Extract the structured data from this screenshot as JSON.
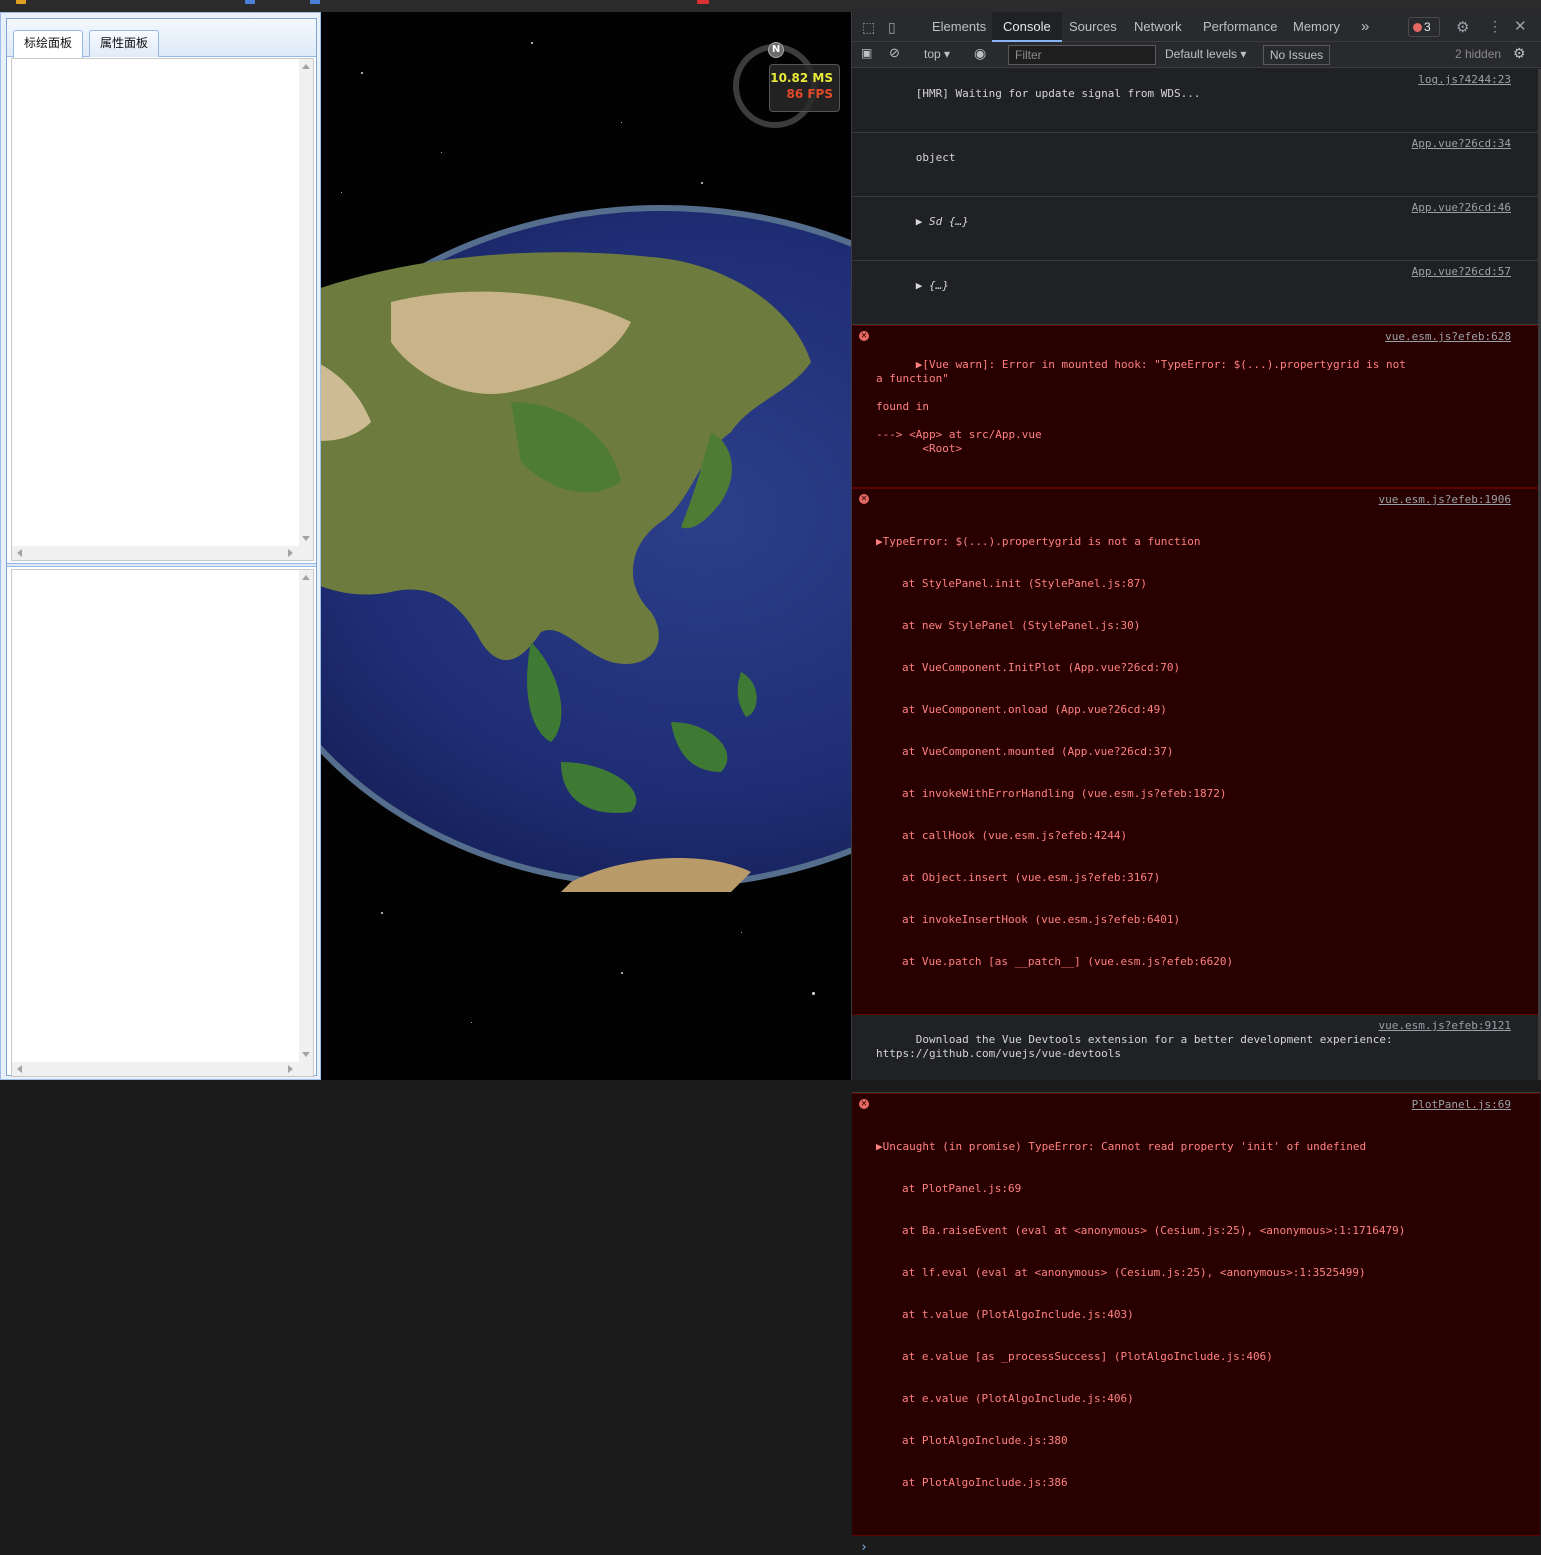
{
  "left_panel": {
    "tabs": [
      {
        "label": "标绘面板",
        "active": true
      },
      {
        "label": "属性面板",
        "active": false
      }
    ]
  },
  "viewport": {
    "perf_ms": "10.82 MS",
    "perf_fps": "86 FPS",
    "compass_label": "N"
  },
  "devtools": {
    "tabs": [
      "Elements",
      "Console",
      "Sources",
      "Network",
      "Performance",
      "Memory"
    ],
    "active_tab": "Console",
    "more_tabs": "»",
    "error_count": "3",
    "toolbar": {
      "context": "top",
      "filter_placeholder": "Filter",
      "levels": "Default levels",
      "issues": "No Issues",
      "hidden": "2 hidden"
    },
    "messages": [
      {
        "type": "log",
        "text": "[HMR] Waiting for update signal from WDS...",
        "source": "log.js?4244:23"
      },
      {
        "type": "log",
        "text": "object",
        "source": "App.vue?26cd:34"
      },
      {
        "type": "log",
        "text": "▶ Sd {…}",
        "source": "App.vue?26cd:46"
      },
      {
        "type": "log",
        "text": "▶ {…}",
        "source": "App.vue?26cd:57"
      },
      {
        "type": "error",
        "text": "▶[Vue warn]: Error in mounted hook: \"TypeError: $(...).propertygrid is not\na function\"\n\nfound in\n\n---> <App> at src/App.vue\n       <Root>",
        "source": "vue.esm.js?efeb:628"
      },
      {
        "type": "error",
        "text": "▶TypeError: $(...).propertygrid is not a function",
        "source": "vue.esm.js?efeb:1906",
        "stack": [
          "at StylePanel.init (StylePanel.js:87)",
          "at new StylePanel (StylePanel.js:30)",
          "at VueComponent.InitPlot (App.vue?26cd:70)",
          "at VueComponent.onload (App.vue?26cd:49)",
          "at VueComponent.mounted (App.vue?26cd:37)",
          "at invokeWithErrorHandling (vue.esm.js?efeb:1872)",
          "at callHook (vue.esm.js?efeb:4244)",
          "at Object.insert (vue.esm.js?efeb:3167)",
          "at invokeInsertHook (vue.esm.js?efeb:6401)",
          "at Vue.patch [as __patch__] (vue.esm.js?efeb:6620)"
        ]
      },
      {
        "type": "log",
        "text": "Download the Vue Devtools extension for a better development experience:\nhttps://github.com/vuejs/vue-devtools",
        "source": "vue.esm.js?efeb:9121"
      },
      {
        "type": "error",
        "text": "▶Uncaught (in promise) TypeError: Cannot read property 'init' of undefined",
        "source": "PlotPanel.js:69",
        "stack": [
          "at PlotPanel.js:69",
          "at Ba.raiseEvent (eval at <anonymous> (Cesium.js:25), <anonymous>:1:1716479)",
          "at lf.eval (eval at <anonymous> (Cesium.js:25), <anonymous>:1:3525499)",
          "at t.value (PlotAlgoInclude.js:403)",
          "at e.value [as _processSuccess] (PlotAlgoInclude.js:406)",
          "at e.value (PlotAlgoInclude.js:406)",
          "at PlotAlgoInclude.js:380",
          "at PlotAlgoInclude.js:386"
        ]
      }
    ],
    "prompt": "›"
  },
  "colors": {
    "error_bg": "#290000",
    "error_text": "#ff8080",
    "accent": "#8ab4f8",
    "panel_border": "#95b8e7"
  }
}
